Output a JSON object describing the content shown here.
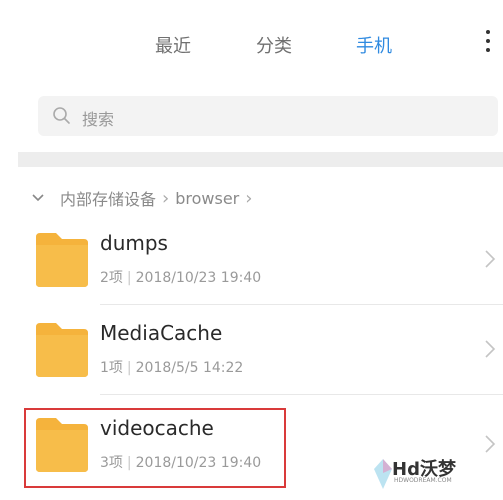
{
  "tabs": [
    {
      "label": "最近",
      "active": false
    },
    {
      "label": "分类",
      "active": false
    },
    {
      "label": "手机",
      "active": true
    }
  ],
  "search": {
    "placeholder": "搜索"
  },
  "breadcrumb": {
    "segments": [
      "内部存储设备",
      "browser"
    ]
  },
  "files": [
    {
      "name": "dumps",
      "count": "2项",
      "date": "2018/10/23 19:40"
    },
    {
      "name": "MediaCache",
      "count": "1项",
      "date": "2018/5/5 14:22"
    },
    {
      "name": "videocache",
      "count": "3项",
      "date": "2018/10/23 19:40"
    }
  ],
  "watermark": {
    "text": "Hd沃梦",
    "sub": "HDWODREAM.COM"
  },
  "colors": {
    "accent": "#2f8ae0",
    "folder": "#f5b33c",
    "highlight": "#d93a3a"
  },
  "icons": {
    "more": "more-vertical-icon",
    "search": "search-icon",
    "folder": "folder-icon",
    "chevron": "chevron-right-icon"
  }
}
